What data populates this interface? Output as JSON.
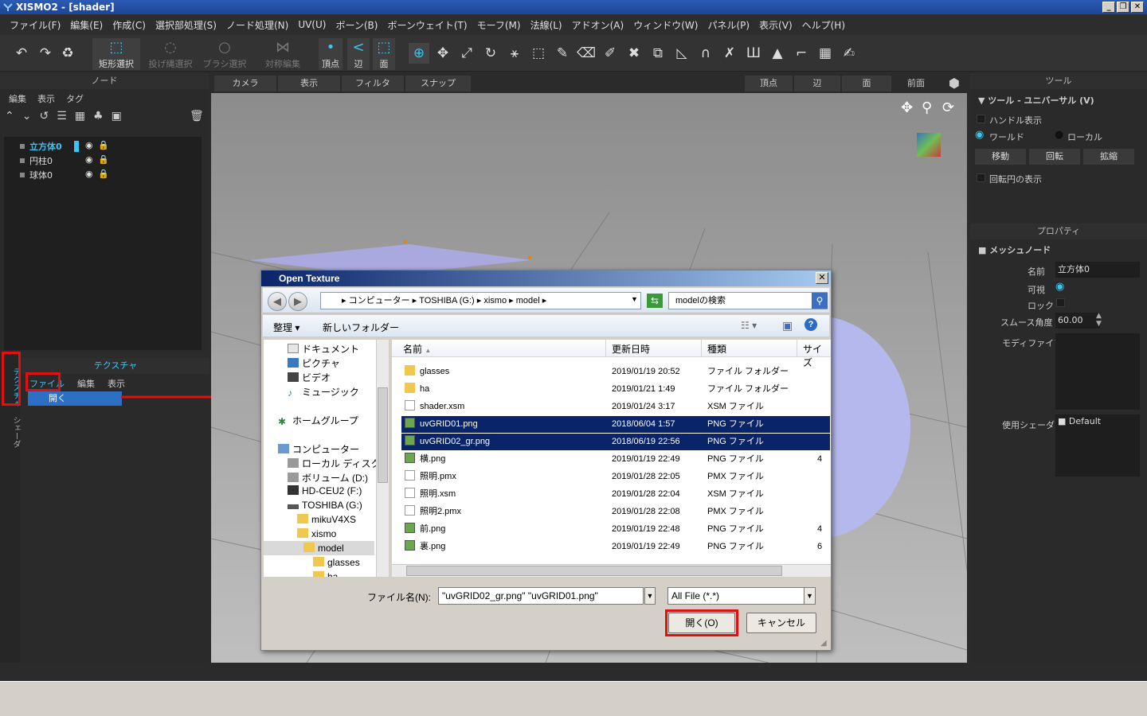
{
  "window": {
    "title": "XISMO2 - [shader]"
  },
  "menu": [
    "ファイル(F)",
    "編集(E)",
    "作成(C)",
    "選択部処理(S)",
    "ノード処理(N)",
    "UV(U)",
    "ボーン(B)",
    "ボーンウェイト(T)",
    "モーフ(M)",
    "法線(L)",
    "アドオン(A)",
    "ウィンドウ(W)",
    "パネル(P)",
    "表示(V)",
    "ヘルプ(H)"
  ],
  "toolbar": {
    "rect_select": "矩形選択",
    "lasso_select": "投げ縄選択",
    "brush_select": "ブラシ選択",
    "symmetric_edit": "対称編集",
    "vertex": "頂点",
    "edge": "辺",
    "face": "面"
  },
  "node_panel": {
    "title": "ノード",
    "menu": [
      "編集",
      "表示",
      "タグ"
    ],
    "nodes": [
      "立方体0",
      "円柱0",
      "球体0"
    ]
  },
  "texture_panel": {
    "title": "テクスチャ",
    "menu": [
      "ファイル",
      "編集",
      "表示"
    ],
    "dropdown_item": "開く",
    "side_tabs": [
      "テクスチャ",
      "シェーダ"
    ]
  },
  "viewport": {
    "tabs": [
      "カメラ",
      "表示",
      "フィルタ",
      "スナップ"
    ],
    "modes": [
      "頂点",
      "辺",
      "面"
    ],
    "view_name": "前面"
  },
  "tool_panel": {
    "title": "ツール",
    "section": "ツール - ユニバーサル (V)",
    "handle_display": "ハンドル表示",
    "world": "ワールド",
    "local": "ローカル",
    "buttons": [
      "移動",
      "回転",
      "拡縮"
    ],
    "rotation_circle": "回転円の表示"
  },
  "property_panel": {
    "title": "プロパティ",
    "section": "メッシュノード",
    "name_label": "名前",
    "name_value": "立方体0",
    "visible_label": "可視",
    "lock_label": "ロック",
    "smooth_label": "スムース角度",
    "smooth_value": "60.00",
    "modifier_label": "モディファイア",
    "shader_label": "使用シェーダ",
    "shader_value": "Default"
  },
  "dialog": {
    "title": "Open Texture",
    "address": [
      "コンピューター",
      "TOSHIBA (G:)",
      "xismo",
      "model"
    ],
    "search_placeholder": "modelの検索",
    "organize": "整理",
    "new_folder": "新しいフォルダー",
    "nav": [
      {
        "label": "ドキュメント"
      },
      {
        "label": "ピクチャ"
      },
      {
        "label": "ビデオ"
      },
      {
        "label": "ミュージック"
      },
      {
        "label": "ホームグループ"
      },
      {
        "label": "コンピューター"
      },
      {
        "label": "ローカル ディスク (C"
      },
      {
        "label": "ボリューム (D:)"
      },
      {
        "label": "HD-CEU2 (F:)"
      },
      {
        "label": "TOSHIBA (G:)"
      },
      {
        "label": "mikuV4XS"
      },
      {
        "label": "xismo"
      },
      {
        "label": "model"
      },
      {
        "label": "glasses"
      },
      {
        "label": "ha"
      }
    ],
    "columns": [
      "名前",
      "更新日時",
      "種類",
      "サイズ"
    ],
    "files": [
      {
        "name": "glasses",
        "date": "2019/01/19 20:52",
        "type": "ファイル フォルダー",
        "size": "",
        "kind": "folder",
        "selected": false
      },
      {
        "name": "ha",
        "date": "2019/01/21 1:49",
        "type": "ファイル フォルダー",
        "size": "",
        "kind": "folder",
        "selected": false
      },
      {
        "name": "shader.xsm",
        "date": "2019/01/24 3:17",
        "type": "XSM ファイル",
        "size": "",
        "kind": "doc",
        "selected": false
      },
      {
        "name": "uvGRID01.png",
        "date": "2018/06/04 1:57",
        "type": "PNG ファイル",
        "size": "",
        "kind": "img",
        "selected": true
      },
      {
        "name": "uvGRID02_gr.png",
        "date": "2018/06/19 22:56",
        "type": "PNG ファイル",
        "size": "",
        "kind": "img",
        "selected": true
      },
      {
        "name": "横.png",
        "date": "2019/01/19 22:49",
        "type": "PNG ファイル",
        "size": "4",
        "kind": "img",
        "selected": false
      },
      {
        "name": "照明.pmx",
        "date": "2019/01/28 22:05",
        "type": "PMX ファイル",
        "size": "",
        "kind": "doc",
        "selected": false
      },
      {
        "name": "照明.xsm",
        "date": "2019/01/28 22:04",
        "type": "XSM ファイル",
        "size": "",
        "kind": "doc",
        "selected": false
      },
      {
        "name": "照明2.pmx",
        "date": "2019/01/28 22:08",
        "type": "PMX ファイル",
        "size": "",
        "kind": "doc",
        "selected": false
      },
      {
        "name": "前.png",
        "date": "2019/01/19 22:48",
        "type": "PNG ファイル",
        "size": "4",
        "kind": "img",
        "selected": false
      },
      {
        "name": "裏.png",
        "date": "2019/01/19 22:49",
        "type": "PNG ファイル",
        "size": "6",
        "kind": "img",
        "selected": false
      }
    ],
    "filename_label": "ファイル名(N):",
    "filename_value": "\"uvGRID02_gr.png\" \"uvGRID01.png\"",
    "filter_value": "All File (*.*)",
    "open_button": "開く(O)",
    "cancel_button": "キャンセル"
  },
  "colors": {
    "accent": "#3cc4f0",
    "highlight": "#e01010",
    "selection": "#0a246a"
  }
}
